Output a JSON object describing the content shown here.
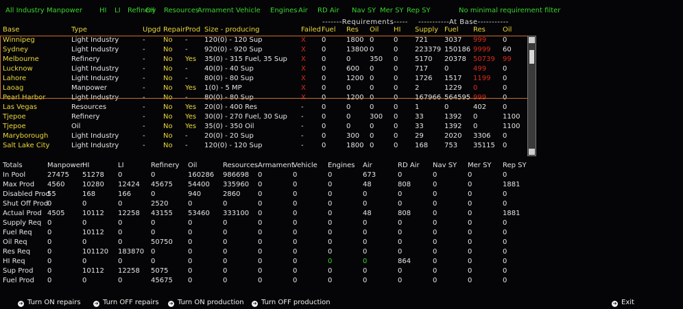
{
  "tabs": [
    "All Industry",
    "Manpower",
    "HI",
    "LI",
    "Refinery",
    "Oil",
    "Resources",
    "Armament",
    "Vehicle",
    "Engines",
    "Air",
    "RD Air",
    "Nav SY",
    "Mer SY",
    "Rep SY",
    "No minimal requirement filter"
  ],
  "groups": {
    "requirements": "-------Requirements-----",
    "at_base": "-----------At Base-----------"
  },
  "headers": [
    "Base",
    "Type",
    "Upgd",
    "Repair",
    "Prod",
    "Size - producing",
    "Failed",
    "Fuel",
    "Res",
    "Oil",
    "HI",
    "Supply",
    "Fuel",
    "Res",
    "Oil"
  ],
  "rows": [
    [
      "Winnipeg",
      "Light Industry",
      "-",
      "No",
      "-",
      "120(0) - 120 Sup",
      "X",
      "0",
      "1800",
      "0",
      "0",
      "721",
      "3037",
      "999",
      "0"
    ],
    [
      "Sydney",
      "Light Industry",
      "-",
      "No",
      "-",
      "920(0) - 920 Sup",
      "X",
      "0",
      "13800",
      "0",
      "0",
      "223379",
      "150186",
      "9999",
      "60"
    ],
    [
      "Melbourne",
      "Refinery",
      "-",
      "No",
      "Yes",
      "35(0) - 315 Fuel, 35 Sup",
      "X",
      "0",
      "0",
      "350",
      "0",
      "5170",
      "20378",
      "50739",
      "99"
    ],
    [
      "Lucknow",
      "Light Industry",
      "-",
      "No",
      "-",
      "40(0) - 40 Sup",
      "X",
      "0",
      "600",
      "0",
      "0",
      "717",
      "0",
      "499",
      "0"
    ],
    [
      "Lahore",
      "Light Industry",
      "-",
      "No",
      "-",
      "80(0) - 80 Sup",
      "X",
      "0",
      "1200",
      "0",
      "0",
      "1726",
      "1517",
      "1199",
      "0"
    ],
    [
      "Laoag",
      "Manpower",
      "-",
      "No",
      "Yes",
      "1(0) - 5 MP",
      "X",
      "0",
      "0",
      "0",
      "0",
      "2",
      "1229",
      "0",
      "0"
    ],
    [
      "Pearl Harbor",
      "Light Industry",
      "-",
      "No",
      "-",
      "80(0) - 80 Sup",
      "X",
      "0",
      "1200",
      "0",
      "0",
      "167966",
      "564595",
      "999",
      "0"
    ],
    [
      "Las Vegas",
      "Resources",
      "-",
      "No",
      "Yes",
      "20(0) - 400 Res",
      "-",
      "0",
      "0",
      "0",
      "0",
      "1",
      "0",
      "402",
      "0"
    ],
    [
      "Tjepoe",
      "Refinery",
      "-",
      "No",
      "Yes",
      "30(0) - 270 Fuel, 30 Sup",
      "-",
      "0",
      "0",
      "300",
      "0",
      "33",
      "1392",
      "0",
      "1100"
    ],
    [
      "Tjepoe",
      "Oil",
      "-",
      "No",
      "Yes",
      "35(0) - 350 Oil",
      "-",
      "0",
      "0",
      "0",
      "0",
      "33",
      "1392",
      "0",
      "1100"
    ],
    [
      "Maryborough",
      "Light Industry",
      "-",
      "No",
      "-",
      "20(0) - 20 Sup",
      "-",
      "0",
      "300",
      "0",
      "0",
      "29",
      "2020",
      "3306",
      "0"
    ],
    [
      "Salt Lake City",
      "Light Industry",
      "-",
      "No",
      "-",
      "120(0) - 120 Sup",
      "-",
      "0",
      "1800",
      "0",
      "0",
      "168",
      "753",
      "35115",
      "0"
    ]
  ],
  "totals_header": [
    "Totals",
    "Manpower",
    "HI",
    "LI",
    "Refinery",
    "Oil",
    "Resources",
    "Armament",
    "Vehicle",
    "Engines",
    "Air",
    "RD Air",
    "Nav SY",
    "Mer SY",
    "Rep SY"
  ],
  "totals": [
    [
      "In Pool",
      "27475",
      "51278",
      "0",
      "0",
      "160286",
      "986698",
      "0",
      "0",
      "0",
      "673",
      "0",
      "0",
      "0",
      "0"
    ],
    [
      "Max Prod",
      "4560",
      "10280",
      "12424",
      "45675",
      "54400",
      "335960",
      "0",
      "0",
      "0",
      "48",
      "808",
      "0",
      "0",
      "1881"
    ],
    [
      "Disabled Prod",
      "55",
      "168",
      "166",
      "0",
      "940",
      "2860",
      "0",
      "0",
      "0",
      "0",
      "0",
      "0",
      "0",
      "0"
    ],
    [
      "Shut Off Prod",
      "0",
      "0",
      "0",
      "2520",
      "0",
      "0",
      "0",
      "0",
      "0",
      "0",
      "0",
      "0",
      "0",
      "0"
    ],
    [
      "Actual Prod",
      "4505",
      "10112",
      "12258",
      "43155",
      "53460",
      "333100",
      "0",
      "0",
      "0",
      "48",
      "808",
      "0",
      "0",
      "1881"
    ],
    [
      "Supply Req",
      "0",
      "0",
      "0",
      "0",
      "0",
      "0",
      "0",
      "0",
      "0",
      "0",
      "0",
      "0",
      "0",
      "0"
    ],
    [
      "Fuel Req",
      "0",
      "10112",
      "0",
      "0",
      "0",
      "0",
      "0",
      "0",
      "0",
      "0",
      "0",
      "0",
      "0",
      "0"
    ],
    [
      "Oil Req",
      "0",
      "0",
      "0",
      "50750",
      "0",
      "0",
      "0",
      "0",
      "0",
      "0",
      "0",
      "0",
      "0",
      "0"
    ],
    [
      "Res Req",
      "0",
      "101120",
      "183870",
      "0",
      "0",
      "0",
      "0",
      "0",
      "0",
      "0",
      "0",
      "0",
      "0",
      "0"
    ],
    [
      "HI Req",
      "0",
      "0",
      "0",
      "0",
      "0",
      "0",
      "0",
      "0",
      "0",
      "0",
      "864",
      "0",
      "0",
      "0"
    ],
    [
      "Sup Prod",
      "0",
      "10112",
      "12258",
      "5075",
      "0",
      "0",
      "0",
      "0",
      "0",
      "0",
      "0",
      "0",
      "0",
      "0"
    ],
    [
      "Fuel Prod",
      "0",
      "0",
      "0",
      "45675",
      "0",
      "0",
      "0",
      "0",
      "0",
      "0",
      "0",
      "0",
      "0",
      "0"
    ]
  ],
  "buttons": {
    "on_repairs": "Turn ON repairs",
    "off_repairs": "Turn OFF repairs",
    "on_production": "Turn ON production",
    "off_production": "Turn OFF production",
    "exit": "Exit"
  },
  "colors": {
    "tab": "#39d62c",
    "header": "#ecd83a",
    "alert": "#e02a1a",
    "highlight_border": "#c8702a"
  }
}
